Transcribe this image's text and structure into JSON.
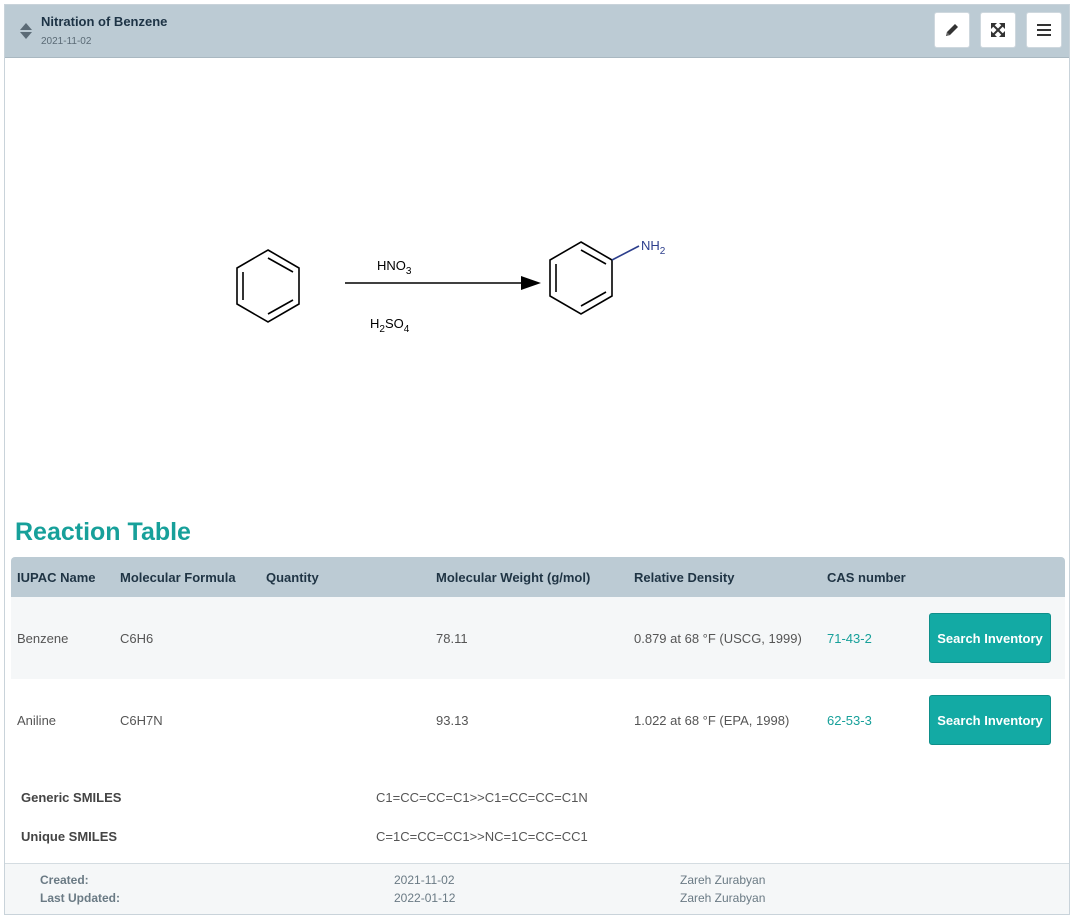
{
  "header": {
    "title": "Nitration of Benzene",
    "date": "2021-11-02"
  },
  "reaction": {
    "reagent_top": "HNO",
    "reagent_top_sub": "3",
    "reagent_bottom_h": "H",
    "reagent_bottom_sub1": "2",
    "reagent_bottom_so": "SO",
    "reagent_bottom_sub2": "4",
    "product_group": "NH",
    "product_group_sub": "2"
  },
  "section_title": "Reaction Table",
  "table": {
    "headers": [
      "IUPAC Name",
      "Molecular Formula",
      "Quantity",
      "Molecular Weight (g/mol)",
      "Relative Density",
      "CAS number"
    ],
    "rows": [
      {
        "name": "Benzene",
        "formula": "C6H6",
        "quantity": "",
        "mw": "78.11",
        "density": "0.879 at 68 °F (USCG, 1999)",
        "cas": "71-43-2",
        "button": "Search Inventory"
      },
      {
        "name": "Aniline",
        "formula": "C6H7N",
        "quantity": "",
        "mw": "93.13",
        "density": "1.022 at 68 °F (EPA, 1998)",
        "cas": "62-53-3",
        "button": "Search Inventory"
      }
    ]
  },
  "smiles": {
    "generic_label": "Generic SMILES",
    "generic_value": "C1=CC=CC=C1>>C1=CC=CC=C1N",
    "unique_label": "Unique SMILES",
    "unique_value": "C=1C=CC=CC1>>NC=1C=CC=CC1"
  },
  "footer": {
    "created_label": "Created:",
    "created_date": "2021-11-02",
    "created_by": "Zareh Zurabyan",
    "updated_label": "Last Updated:",
    "updated_date": "2022-01-12",
    "updated_by": "Zareh Zurabyan"
  },
  "icons": {
    "sort": "sort-icon",
    "edit": "pencil-icon",
    "expand": "expand-icon",
    "menu": "hamburger-menu-icon"
  },
  "colors": {
    "accent": "#17a09a",
    "header_bg": "#bccbd4",
    "button_bg": "#13aaa4"
  }
}
